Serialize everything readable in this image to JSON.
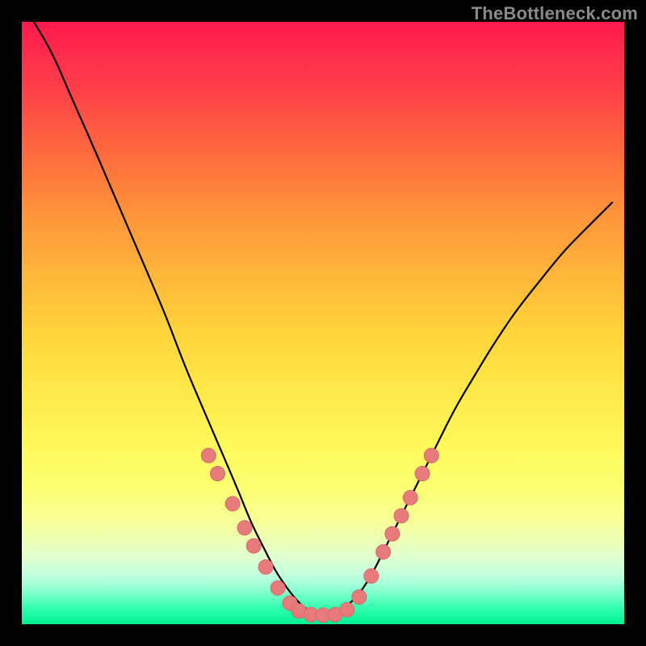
{
  "watermark": "TheBottleneck.com",
  "colors": {
    "background": "#000000",
    "curve_stroke": "#000000",
    "marker_fill": "#e77b7b",
    "marker_stroke": "#d86a6a"
  },
  "chart_data": {
    "type": "line",
    "title": "",
    "xlabel": "",
    "ylabel": "",
    "xlim": [
      0,
      100
    ],
    "ylim": [
      0,
      100
    ],
    "grid": false,
    "series": [
      {
        "name": "bottleneck-curve",
        "x": [
          2,
          5,
          8,
          12,
          15,
          18,
          21,
          24,
          27,
          30,
          33,
          36,
          38,
          40,
          42,
          44,
          46,
          48,
          50,
          52,
          54,
          56,
          58,
          60,
          63,
          66,
          69,
          72,
          75,
          78,
          82,
          86,
          90,
          94,
          98
        ],
        "values": [
          100,
          95,
          88,
          79,
          72,
          65,
          58,
          51,
          43,
          36,
          29,
          22,
          17,
          13,
          9,
          6,
          3.5,
          2,
          1.5,
          2,
          3,
          5,
          8,
          12,
          18,
          24,
          30,
          36,
          41,
          46,
          52,
          57,
          62,
          66,
          70
        ]
      }
    ],
    "annotations": [
      {
        "type": "marker",
        "x": 31,
        "y": 28
      },
      {
        "type": "marker",
        "x": 32.5,
        "y": 25
      },
      {
        "type": "marker",
        "x": 35,
        "y": 20
      },
      {
        "type": "marker",
        "x": 37,
        "y": 16
      },
      {
        "type": "marker",
        "x": 38.5,
        "y": 13
      },
      {
        "type": "marker",
        "x": 40.5,
        "y": 9.5
      },
      {
        "type": "marker",
        "x": 42.5,
        "y": 6
      },
      {
        "type": "marker",
        "x": 44.5,
        "y": 3.5
      },
      {
        "type": "marker",
        "x": 46,
        "y": 2.2
      },
      {
        "type": "marker",
        "x": 48,
        "y": 1.6
      },
      {
        "type": "marker",
        "x": 50,
        "y": 1.5
      },
      {
        "type": "marker",
        "x": 52,
        "y": 1.6
      },
      {
        "type": "marker",
        "x": 54,
        "y": 2.4
      },
      {
        "type": "marker",
        "x": 56,
        "y": 4.5
      },
      {
        "type": "marker",
        "x": 58,
        "y": 8
      },
      {
        "type": "marker",
        "x": 60,
        "y": 12
      },
      {
        "type": "marker",
        "x": 61.5,
        "y": 15
      },
      {
        "type": "marker",
        "x": 63,
        "y": 18
      },
      {
        "type": "marker",
        "x": 64.5,
        "y": 21
      },
      {
        "type": "marker",
        "x": 66.5,
        "y": 25
      },
      {
        "type": "marker",
        "x": 68,
        "y": 28
      }
    ]
  }
}
